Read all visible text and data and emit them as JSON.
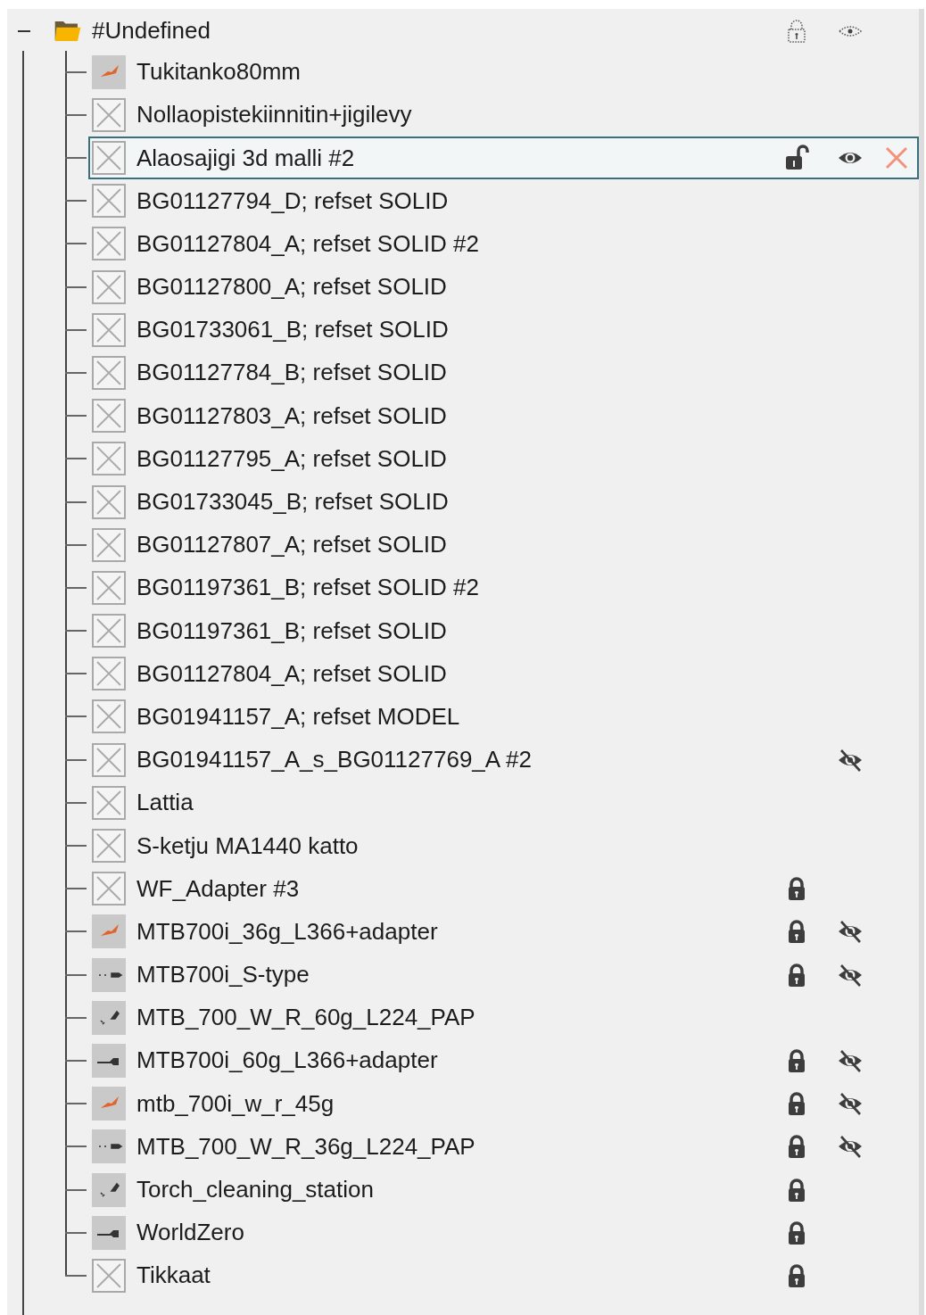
{
  "tree": {
    "label": "#Undefined",
    "expanded": true,
    "lock_mixed": true,
    "visibility_mixed": true,
    "children": [
      {
        "label": "Tukitanko80mm",
        "has_preview": true,
        "selected": false
      },
      {
        "label": "Nollaopistekiinnitin+jigilevy",
        "has_preview": false,
        "selected": false
      },
      {
        "label": "Alaosajigi 3d malli #2",
        "has_preview": false,
        "locked": false,
        "visible": true,
        "selected": true
      },
      {
        "label": "BG01127794_D; refset SOLID",
        "has_preview": false,
        "selected": false
      },
      {
        "label": "BG01127804_A; refset SOLID #2",
        "has_preview": false,
        "selected": false
      },
      {
        "label": "BG01127800_A; refset SOLID",
        "has_preview": false,
        "selected": false
      },
      {
        "label": "BG01733061_B; refset SOLID",
        "has_preview": false,
        "selected": false
      },
      {
        "label": "BG01127784_B; refset SOLID",
        "has_preview": false,
        "selected": false
      },
      {
        "label": "BG01127803_A; refset SOLID",
        "has_preview": false,
        "selected": false
      },
      {
        "label": "BG01127795_A; refset SOLID",
        "has_preview": false,
        "selected": false
      },
      {
        "label": "BG01733045_B; refset SOLID",
        "has_preview": false,
        "selected": false
      },
      {
        "label": "BG01127807_A; refset SOLID",
        "has_preview": false,
        "selected": false
      },
      {
        "label": "BG01197361_B; refset SOLID #2",
        "has_preview": false,
        "selected": false
      },
      {
        "label": "BG01197361_B; refset SOLID",
        "has_preview": false,
        "selected": false
      },
      {
        "label": "BG01127804_A; refset SOLID",
        "has_preview": false,
        "selected": false
      },
      {
        "label": "BG01941157_A; refset MODEL",
        "has_preview": false,
        "selected": false
      },
      {
        "label": "BG01941157_A_s_BG01127769_A #2",
        "has_preview": false,
        "visible": false,
        "selected": false
      },
      {
        "label": "Lattia",
        "has_preview": false,
        "selected": false
      },
      {
        "label": "S-ketju MA1440 katto",
        "has_preview": false,
        "selected": false
      },
      {
        "label": "WF_Adapter #3",
        "has_preview": false,
        "locked": true,
        "selected": false
      },
      {
        "label": "MTB700i_36g_L366+adapter",
        "has_preview": true,
        "locked": true,
        "visible": false,
        "selected": false
      },
      {
        "label": "MTB700i_S-type",
        "has_preview": true,
        "locked": true,
        "visible": false,
        "selected": false
      },
      {
        "label": "MTB_700_W_R_60g_L224_PAP",
        "has_preview": true,
        "selected": false
      },
      {
        "label": "MTB700i_60g_L366+adapter",
        "has_preview": true,
        "locked": true,
        "visible": false,
        "selected": false
      },
      {
        "label": "mtb_700i_w_r_45g",
        "has_preview": true,
        "locked": true,
        "visible": false,
        "selected": false
      },
      {
        "label": "MTB_700_W_R_36g_L224_PAP",
        "has_preview": true,
        "locked": true,
        "visible": false,
        "selected": false
      },
      {
        "label": "Torch_cleaning_station",
        "has_preview": true,
        "locked": true,
        "selected": false
      },
      {
        "label": "WorldZero",
        "has_preview": true,
        "locked": true,
        "selected": false
      },
      {
        "label": "Tikkaat",
        "has_preview": false,
        "locked": true,
        "selected": false
      }
    ]
  }
}
